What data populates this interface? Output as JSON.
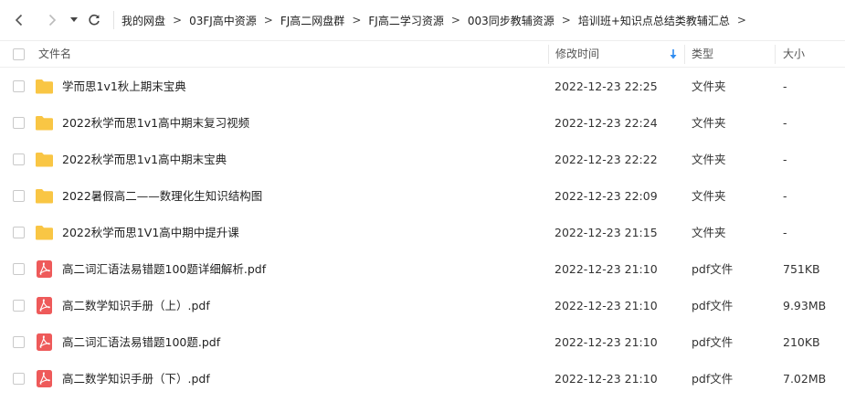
{
  "breadcrumbs": [
    "我的网盘",
    "03FJ高中资源",
    "FJ高二网盘群",
    "FJ高二学习资源",
    "003同步教辅资源",
    "培训班+知识点总结类教辅汇总"
  ],
  "breadcrumb_separator": ">",
  "columns": {
    "name": "文件名",
    "modified": "修改时间",
    "type": "类型",
    "size": "大小"
  },
  "colors": {
    "folder": "#F9C544",
    "pdf": "#EE5A5A",
    "sort_arrow": "#2F8CF0"
  },
  "files": [
    {
      "icon": "folder-icon",
      "name": "学而思1v1秋上期末宝典",
      "modified": "2022-12-23 22:25",
      "type": "文件夹",
      "size": "-"
    },
    {
      "icon": "folder-icon",
      "name": "2022秋学而思1v1高中期末复习视频",
      "modified": "2022-12-23 22:24",
      "type": "文件夹",
      "size": "-"
    },
    {
      "icon": "folder-icon",
      "name": "2022秋学而思1v1高中期末宝典",
      "modified": "2022-12-23 22:22",
      "type": "文件夹",
      "size": "-"
    },
    {
      "icon": "folder-icon",
      "name": "2022暑假高二——数理化生知识结构图",
      "modified": "2022-12-23 22:09",
      "type": "文件夹",
      "size": "-"
    },
    {
      "icon": "folder-icon",
      "name": "2022秋学而思1V1高中期中提升课",
      "modified": "2022-12-23 21:15",
      "type": "文件夹",
      "size": "-"
    },
    {
      "icon": "pdf-icon",
      "name": "高二词汇语法易错题100题详细解析.pdf",
      "modified": "2022-12-23 21:10",
      "type": "pdf文件",
      "size": "751KB"
    },
    {
      "icon": "pdf-icon",
      "name": "高二数学知识手册（上）.pdf",
      "modified": "2022-12-23 21:10",
      "type": "pdf文件",
      "size": "9.93MB"
    },
    {
      "icon": "pdf-icon",
      "name": "高二词汇语法易错题100题.pdf",
      "modified": "2022-12-23 21:10",
      "type": "pdf文件",
      "size": "210KB"
    },
    {
      "icon": "pdf-icon",
      "name": "高二数学知识手册（下）.pdf",
      "modified": "2022-12-23 21:10",
      "type": "pdf文件",
      "size": "7.02MB"
    }
  ]
}
